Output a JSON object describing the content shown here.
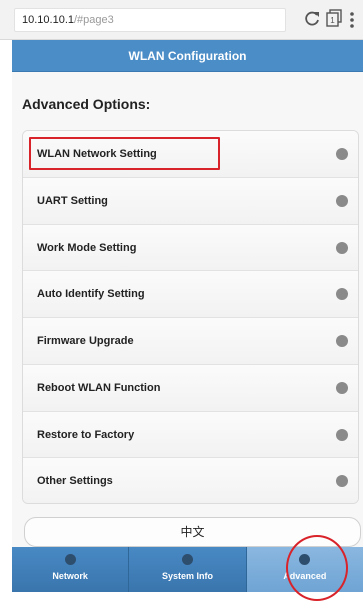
{
  "browser": {
    "url_host": "10.10.10.1",
    "url_path": "/#page3"
  },
  "header": {
    "title": "WLAN Configuration"
  },
  "main": {
    "section_title": "Advanced Options:",
    "items": [
      {
        "label": "WLAN Network Setting"
      },
      {
        "label": "UART Setting"
      },
      {
        "label": "Work Mode Setting"
      },
      {
        "label": "Auto Identify Setting"
      },
      {
        "label": "Firmware Upgrade"
      },
      {
        "label": "Reboot WLAN Function"
      },
      {
        "label": "Restore to Factory"
      },
      {
        "label": "Other Settings"
      }
    ],
    "language_button": "中文"
  },
  "navbar": {
    "items": [
      {
        "label": "Network"
      },
      {
        "label": "System Info"
      },
      {
        "label": "Advanced"
      }
    ],
    "active": "Advanced"
  },
  "colors": {
    "header_bg": "#4a8dc7",
    "nav_bg": "#3d7ab3",
    "nav_active_bg": "#7aacd9",
    "highlight": "#d9232a",
    "dot": "#8a8a8a"
  },
  "icons": [
    "reload-icon",
    "tabs-icon",
    "menu-icon",
    "status-dot-icon",
    "nav-dot-icon"
  ]
}
